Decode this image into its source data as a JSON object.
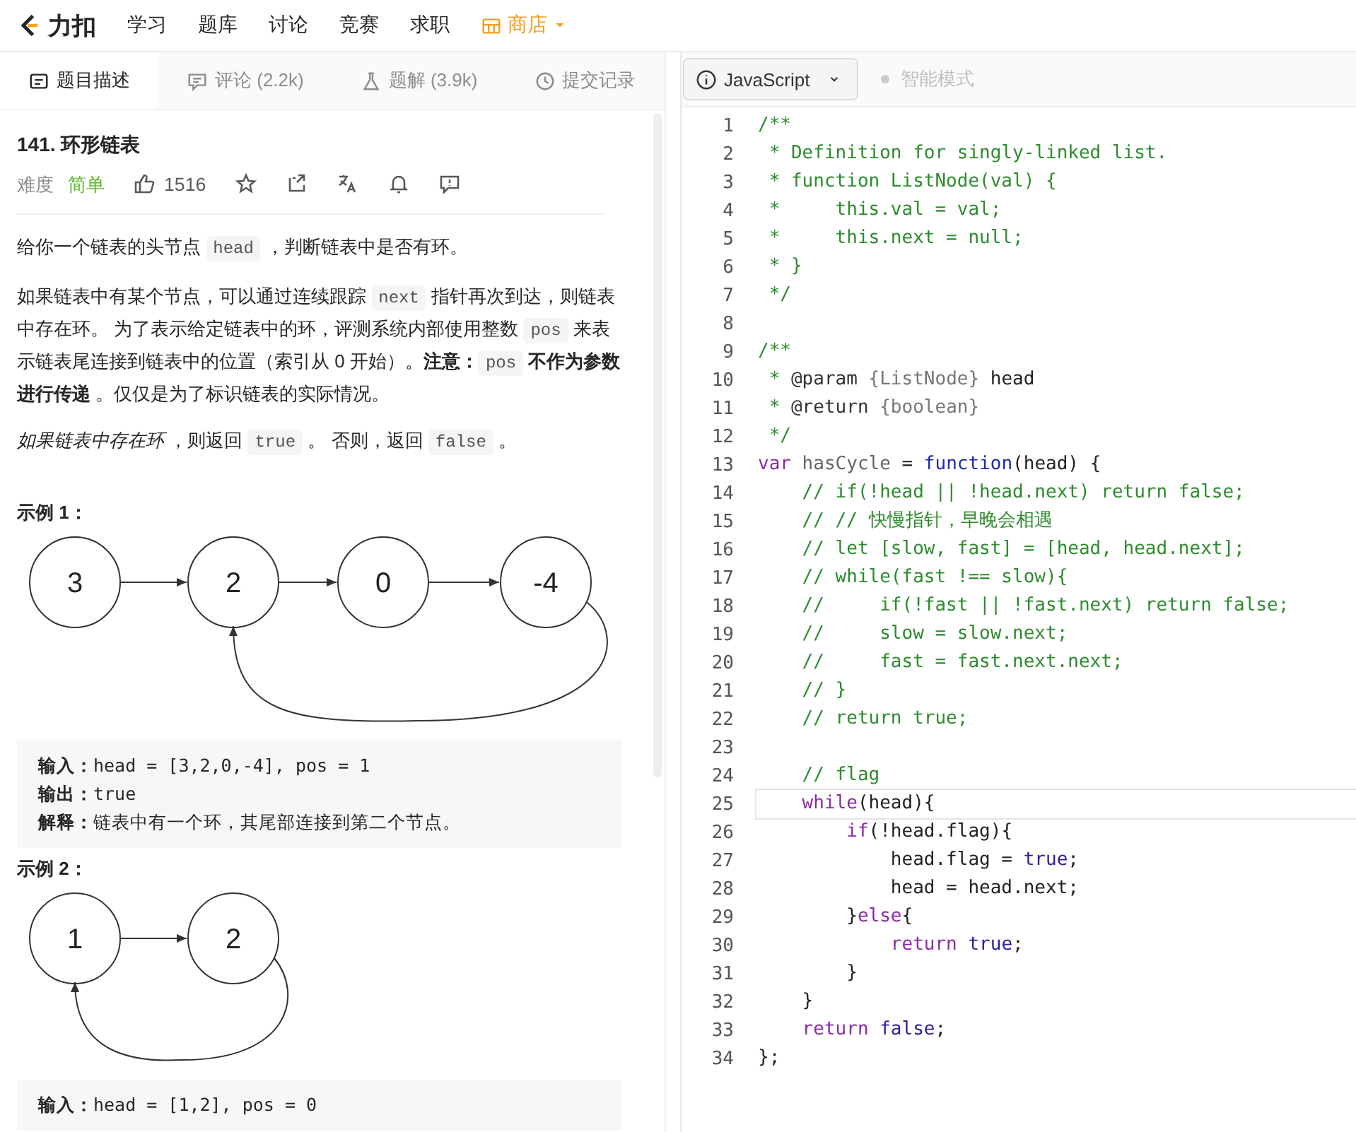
{
  "nav": {
    "logo": "力扣",
    "items": [
      {
        "label": "学习",
        "kind": "plain"
      },
      {
        "label": "题库",
        "kind": "plain"
      },
      {
        "label": "讨论",
        "kind": "plain"
      },
      {
        "label": "竞赛",
        "kind": "plain"
      },
      {
        "label": "求职",
        "kind": "plain"
      },
      {
        "label": "商店",
        "kind": "store"
      }
    ]
  },
  "tabs": [
    {
      "label": "题目描述",
      "selected": true,
      "kind": "description"
    },
    {
      "label": "评论 (2.2k)",
      "selected": false,
      "kind": "comments"
    },
    {
      "label": "题解 (3.9k)",
      "selected": false,
      "kind": "solutions"
    },
    {
      "label": "提交记录",
      "selected": false,
      "kind": "submissions"
    }
  ],
  "problem": {
    "title": "141. 环形链表",
    "difficulty_label": "难度",
    "difficulty": "简单",
    "likes": "1516",
    "paragraphs": [
      [
        {
          "text": "给你一个链表的头节点 ",
          "kind": "text"
        },
        {
          "text": "head",
          "kind": "code"
        },
        {
          "text": " ，判断链表中是否有环。",
          "kind": "text"
        }
      ],
      [
        {
          "text": "如果链表中有某个节点，可以通过连续跟踪 ",
          "kind": "text"
        },
        {
          "text": "next",
          "kind": "code"
        },
        {
          "text": " 指针再次到达，则链表中存在环。 为了表示给定链表中的环，评测系统内部使用整数 ",
          "kind": "text"
        },
        {
          "text": "pos",
          "kind": "code"
        },
        {
          "text": " 来表示链表尾连接到链表中的位置（索引从 0 开始）。",
          "kind": "text"
        },
        {
          "text": "注意：",
          "kind": "bold"
        },
        {
          "text": "pos",
          "kind": "code"
        },
        {
          "text": " 不作为参数进行传递 ",
          "kind": "bold"
        },
        {
          "text": "。仅仅是为了标识链表的实际情况。",
          "kind": "text"
        }
      ],
      [
        {
          "text": "如果链表中存在环",
          "kind": "italic"
        },
        {
          "text": " ，则返回 ",
          "kind": "text"
        },
        {
          "text": "true",
          "kind": "code"
        },
        {
          "text": " 。 否则，返回 ",
          "kind": "text"
        },
        {
          "text": "false",
          "kind": "code"
        },
        {
          "text": " 。",
          "kind": "text"
        }
      ]
    ],
    "examples": [
      {
        "heading": "示例 1：",
        "nodes": [
          {
            "value": "3",
            "loop_target": false
          },
          {
            "value": "2",
            "loop_target": true
          },
          {
            "value": "0",
            "loop_target": false
          },
          {
            "value": "-4",
            "loop_target": false
          }
        ],
        "io": [
          {
            "label": "输入：",
            "text": "head = [3,2,0,-4], pos = 1"
          },
          {
            "label": "输出：",
            "text": "true"
          },
          {
            "label": "解释：",
            "text": "链表中有一个环，其尾部连接到第二个节点。"
          }
        ]
      },
      {
        "heading": "示例 2：",
        "nodes": [
          {
            "value": "1",
            "loop_target": true
          },
          {
            "value": "2",
            "loop_target": false
          }
        ],
        "io": [
          {
            "label": "输入：",
            "text": "head = [1,2], pos = 0"
          }
        ]
      }
    ]
  },
  "editor": {
    "language": "JavaScript",
    "smart_mode": {
      "label": "智能模式",
      "on": false
    },
    "lines": [
      {
        "n": "1",
        "current": false,
        "tokens": [
          {
            "text": "/**",
            "kind": "comment"
          }
        ]
      },
      {
        "n": "2",
        "current": false,
        "tokens": [
          {
            "text": " * Definition for singly-linked list.",
            "kind": "comment"
          }
        ]
      },
      {
        "n": "3",
        "current": false,
        "tokens": [
          {
            "text": " * function ListNode(val) {",
            "kind": "comment"
          }
        ]
      },
      {
        "n": "4",
        "current": false,
        "tokens": [
          {
            "text": " *     this.val = val;",
            "kind": "comment"
          }
        ]
      },
      {
        "n": "5",
        "current": false,
        "tokens": [
          {
            "text": " *     this.next = null;",
            "kind": "comment"
          }
        ]
      },
      {
        "n": "6",
        "current": false,
        "tokens": [
          {
            "text": " * }",
            "kind": "comment"
          }
        ]
      },
      {
        "n": "7",
        "current": false,
        "tokens": [
          {
            "text": " */",
            "kind": "comment"
          }
        ]
      },
      {
        "n": "8",
        "current": false
      },
      {
        "n": "9",
        "current": false,
        "tokens": [
          {
            "text": "/**",
            "kind": "comment"
          }
        ]
      },
      {
        "n": "10",
        "current": false,
        "tokens": [
          {
            "text": " * ",
            "kind": "comment"
          },
          {
            "text": "@param",
            "kind": "tag"
          },
          {
            "text": " {ListNode}",
            "kind": "type"
          },
          {
            "text": " head",
            "kind": "plain"
          }
        ]
      },
      {
        "n": "11",
        "current": false,
        "tokens": [
          {
            "text": " * ",
            "kind": "comment"
          },
          {
            "text": "@return",
            "kind": "tag"
          },
          {
            "text": " {boolean}",
            "kind": "type"
          }
        ]
      },
      {
        "n": "12",
        "current": false,
        "tokens": [
          {
            "text": " */",
            "kind": "comment"
          }
        ]
      },
      {
        "n": "13",
        "current": false,
        "tokens": [
          {
            "text": "var",
            "kind": "keyword"
          },
          {
            "text": " hasCycle",
            "kind": "def"
          },
          {
            "text": " = ",
            "kind": "plain"
          },
          {
            "text": "function",
            "kind": "func"
          },
          {
            "text": "(head) {",
            "kind": "plain"
          }
        ]
      },
      {
        "n": "14",
        "current": false,
        "tokens": [
          {
            "text": "    // if(!head || !head.next) return false;",
            "kind": "comment"
          }
        ]
      },
      {
        "n": "15",
        "current": false,
        "tokens": [
          {
            "text": "    // // 快慢指针，早晚会相遇",
            "kind": "comment"
          }
        ]
      },
      {
        "n": "16",
        "current": false,
        "tokens": [
          {
            "text": "    // let [slow, fast] = [head, head.next];",
            "kind": "comment"
          }
        ]
      },
      {
        "n": "17",
        "current": false,
        "tokens": [
          {
            "text": "    // while(fast !== slow){",
            "kind": "comment"
          }
        ]
      },
      {
        "n": "18",
        "current": false,
        "tokens": [
          {
            "text": "    //     if(!fast || !fast.next) return false;",
            "kind": "comment"
          }
        ]
      },
      {
        "n": "19",
        "current": false,
        "tokens": [
          {
            "text": "    //     slow = slow.next;",
            "kind": "comment"
          }
        ]
      },
      {
        "n": "20",
        "current": false,
        "tokens": [
          {
            "text": "    //     fast = fast.next.next;",
            "kind": "comment"
          }
        ]
      },
      {
        "n": "21",
        "current": false,
        "tokens": [
          {
            "text": "    // }",
            "kind": "comment"
          }
        ]
      },
      {
        "n": "22",
        "current": false,
        "tokens": [
          {
            "text": "    // return true;",
            "kind": "comment"
          }
        ]
      },
      {
        "n": "23",
        "current": false
      },
      {
        "n": "24",
        "current": false,
        "tokens": [
          {
            "text": "    // flag",
            "kind": "comment"
          }
        ]
      },
      {
        "n": "25",
        "current": true,
        "tokens": [
          {
            "text": "    while",
            "kind": "keyword"
          },
          {
            "text": "(head){",
            "kind": "plain"
          }
        ]
      },
      {
        "n": "26",
        "current": false,
        "tokens": [
          {
            "text": "        if",
            "kind": "keyword"
          },
          {
            "text": "(!head.flag){",
            "kind": "plain"
          }
        ]
      },
      {
        "n": "27",
        "current": false,
        "tokens": [
          {
            "text": "            head.flag = ",
            "kind": "plain"
          },
          {
            "text": "true",
            "kind": "atom"
          },
          {
            "text": ";",
            "kind": "plain"
          }
        ]
      },
      {
        "n": "28",
        "current": false,
        "tokens": [
          {
            "text": "            head = head.next;",
            "kind": "plain"
          }
        ]
      },
      {
        "n": "29",
        "current": false,
        "tokens": [
          {
            "text": "        }",
            "kind": "plain"
          },
          {
            "text": "else",
            "kind": "keyword"
          },
          {
            "text": "{",
            "kind": "plain"
          }
        ]
      },
      {
        "n": "30",
        "current": false,
        "tokens": [
          {
            "text": "            return",
            "kind": "keyword"
          },
          {
            "text": " true",
            "kind": "atom"
          },
          {
            "text": ";",
            "kind": "plain"
          }
        ]
      },
      {
        "n": "31",
        "current": false,
        "tokens": [
          {
            "text": "        }",
            "kind": "plain"
          }
        ]
      },
      {
        "n": "32",
        "current": false,
        "tokens": [
          {
            "text": "    }",
            "kind": "plain"
          }
        ]
      },
      {
        "n": "33",
        "current": false,
        "tokens": [
          {
            "text": "    return",
            "kind": "keyword"
          },
          {
            "text": " false",
            "kind": "atom"
          },
          {
            "text": ";",
            "kind": "plain"
          }
        ]
      },
      {
        "n": "34",
        "current": false,
        "tokens": [
          {
            "text": "};",
            "kind": "plain"
          }
        ]
      }
    ]
  }
}
